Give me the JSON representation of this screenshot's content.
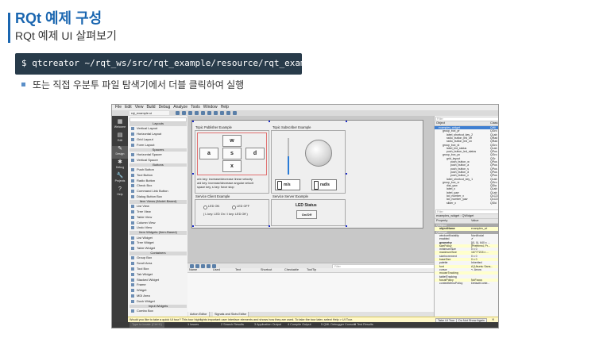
{
  "slide": {
    "title": "RQt 예제 구성",
    "subtitle": "RQt 예제 UI 살펴보기",
    "command": "$ qtcreator ~/rqt_ws/src/rqt_example/resource/rqt_example.ui",
    "bullet": "또는 직접 우분투 파일 탐색기에서 더블 클릭하여 실행",
    "accent_color": "#1a66b0",
    "command_bg": "#283b4a"
  },
  "qt": {
    "menu": [
      "File",
      "Edit",
      "View",
      "Build",
      "Debug",
      "Analyze",
      "Tools",
      "Window",
      "Help"
    ],
    "file_tab": "rqt_example.ui",
    "modes": [
      {
        "icon": "grid-icon",
        "label": "Welcome"
      },
      {
        "icon": "edit-icon",
        "label": "Edit"
      },
      {
        "icon": "design-icon",
        "label": "Design"
      },
      {
        "icon": "debug-icon",
        "label": "Debug"
      },
      {
        "icon": "projects-icon",
        "label": "Projects"
      },
      {
        "icon": "help-icon",
        "label": "Help"
      }
    ],
    "widget_box": [
      {
        "t": "cat",
        "label": "Layouts"
      },
      {
        "t": "item",
        "label": "Vertical Layout"
      },
      {
        "t": "item",
        "label": "Horizontal Layout"
      },
      {
        "t": "item",
        "label": "Grid Layout"
      },
      {
        "t": "item",
        "label": "Form Layout"
      },
      {
        "t": "cat",
        "label": "Spacers"
      },
      {
        "t": "item",
        "label": "Horizontal Spacer"
      },
      {
        "t": "item",
        "label": "Vertical Spacer"
      },
      {
        "t": "cat",
        "label": "Buttons"
      },
      {
        "t": "item",
        "label": "Push Button"
      },
      {
        "t": "item",
        "label": "Tool Button"
      },
      {
        "t": "item",
        "label": "Radio Button"
      },
      {
        "t": "item",
        "label": "Check Box"
      },
      {
        "t": "item",
        "label": "Command Link Button"
      },
      {
        "t": "item",
        "label": "Dialog Button Box"
      },
      {
        "t": "cat",
        "label": "Item Views (Model-Based)"
      },
      {
        "t": "item",
        "label": "List View"
      },
      {
        "t": "item",
        "label": "Tree View"
      },
      {
        "t": "item",
        "label": "Table View"
      },
      {
        "t": "item",
        "label": "Column View"
      },
      {
        "t": "item",
        "label": "Undo View"
      },
      {
        "t": "cat",
        "label": "Item Widgets (Item-Based)"
      },
      {
        "t": "item",
        "label": "List Widget"
      },
      {
        "t": "item",
        "label": "Tree Widget"
      },
      {
        "t": "item",
        "label": "Table Widget"
      },
      {
        "t": "cat",
        "label": "Containers"
      },
      {
        "t": "item",
        "label": "Group Box"
      },
      {
        "t": "item",
        "label": "Scroll Area"
      },
      {
        "t": "item",
        "label": "Tool Box"
      },
      {
        "t": "item",
        "label": "Tab Widget"
      },
      {
        "t": "item",
        "label": "Stacked Widget"
      },
      {
        "t": "item",
        "label": "Frame"
      },
      {
        "t": "item",
        "label": "Widget"
      },
      {
        "t": "item",
        "label": "MDI Area"
      },
      {
        "t": "item",
        "label": "Dock Widget"
      },
      {
        "t": "cat",
        "label": "Input Widgets"
      },
      {
        "t": "item",
        "label": "Combo Box"
      }
    ],
    "form": {
      "publisher_title": "Topic Publisher Example",
      "subscriber_title": "Topic Subscriber Example",
      "keys": [
        "w",
        "a",
        "s",
        "d",
        "x"
      ],
      "help_line1": "w/x key: increase/decrease linear velocity",
      "help_line2": "a/d key: increase/decrease angular velocit",
      "help_line3": "space key, s key: force stop",
      "lcd_digit": "0",
      "lcd_unit_1": "m/s",
      "lcd_unit_2": "rad/s",
      "service_client_title": "Service Client Example",
      "led_on": "LED ON",
      "led_off": "LED OFF",
      "client_help": "( L key: LED On / l key: LED Off )",
      "service_server_title": "Service Server Example",
      "led_status": "LED Status",
      "onoff": "On/Off"
    },
    "action_editor": {
      "filter": "Filter",
      "columns": [
        "Name",
        "Used",
        "Text",
        "Shortcut",
        "Checkable",
        "ToolTip"
      ],
      "tabs": [
        "Action Editor",
        "Signals and Slots Editor"
      ]
    },
    "object_inspector": {
      "filter": "Filter",
      "col_object": "Object",
      "col_class": "Class",
      "rows": [
        {
          "indent": 1,
          "name": "examples_widget",
          "cls": "QWi",
          "sel": true
        },
        {
          "indent": 2,
          "name": "group_box_pr",
          "cls": "QGro"
        },
        {
          "indent": 3,
          "name": "label_shortcut_key_2",
          "cls": "QLab"
        },
        {
          "indent": 3,
          "name": "radio_button_led_off",
          "cls": "QRad"
        },
        {
          "indent": 3,
          "name": "radio_button_led_on",
          "cls": "QRad"
        },
        {
          "indent": 2,
          "name": "group_box_st",
          "cls": "QGro"
        },
        {
          "indent": 3,
          "name": "label_led_status",
          "cls": "QLab"
        },
        {
          "indent": 3,
          "name": "push_button_led_status",
          "cls": "QPus"
        },
        {
          "indent": 2,
          "name": "group_box_pc",
          "cls": "QGro"
        },
        {
          "indent": 3,
          "name": "grid_layout",
          "cls": "QGr"
        },
        {
          "indent": 4,
          "name": "push_button_w",
          "cls": "QPus"
        },
        {
          "indent": 4,
          "name": "push_button_a",
          "cls": "QPus"
        },
        {
          "indent": 4,
          "name": "push_button_s",
          "cls": "QPus"
        },
        {
          "indent": 4,
          "name": "push_button_d",
          "cls": "QPus"
        },
        {
          "indent": 4,
          "name": "push_button_x",
          "cls": "QPus"
        },
        {
          "indent": 3,
          "name": "label_shortcut_key_1",
          "cls": "QLab"
        },
        {
          "indent": 2,
          "name": "group_box_vr",
          "cls": "QGro"
        },
        {
          "indent": 3,
          "name": "dial_yaw",
          "cls": "QDia"
        },
        {
          "indent": 3,
          "name": "label_x",
          "cls": "QLab"
        },
        {
          "indent": 3,
          "name": "label_yaw",
          "cls": "QLab"
        },
        {
          "indent": 3,
          "name": "lcd_number_x",
          "cls": "QLCD"
        },
        {
          "indent": 3,
          "name": "lcd_number_yaw",
          "cls": "QLCD"
        },
        {
          "indent": 3,
          "name": "slider_x",
          "cls": "QSld"
        }
      ]
    },
    "property_editor": {
      "filter": "Filter",
      "object_line": "examples_widget : QWidget",
      "col_property": "Property",
      "col_value": "Value",
      "rows": [
        {
          "kind": "cat",
          "name": "QObject",
          "value": ""
        },
        {
          "kind": "hl",
          "name": "objectName",
          "value": "examples_wi"
        },
        {
          "kind": "cat",
          "name": "QWidget",
          "value": ""
        },
        {
          "kind": "row",
          "name": "windowModality",
          "value": "NonModal"
        },
        {
          "kind": "row",
          "name": "enabled",
          "value": "✔"
        },
        {
          "kind": "row",
          "name": "geometry",
          "value": "[(0, 0), 640 x ..."
        },
        {
          "kind": "hl",
          "name": "sizePolicy",
          "value": "[Preferred, Pr..."
        },
        {
          "kind": "row",
          "name": "minimumSize",
          "value": "0 x 0"
        },
        {
          "kind": "hl",
          "name": "maximumSize",
          "value": "16777215 x ..."
        },
        {
          "kind": "row",
          "name": "sizeIncrement",
          "value": "0 x 0"
        },
        {
          "kind": "hl",
          "name": "baseSize",
          "value": "0 x 0"
        },
        {
          "kind": "row",
          "name": "palette",
          "value": "Inherited"
        },
        {
          "kind": "hl",
          "name": "font",
          "value": "A  [Ubuntu Sans..."
        },
        {
          "kind": "row",
          "name": "cursor",
          "value": "↖ Arrow"
        },
        {
          "kind": "hl",
          "name": "mouseTracking",
          "value": ""
        },
        {
          "kind": "row",
          "name": "tabletTracking",
          "value": ""
        },
        {
          "kind": "hl",
          "name": "focusPolicy",
          "value": "NoFocus"
        },
        {
          "kind": "row",
          "name": "contextMenuPolicy",
          "value": "DefaultConte..."
        }
      ]
    },
    "tour": {
      "message": "Would you like to take a quick UI tour? This tour highlights important user interface elements and shows how they are used. To take the tour later, select Help > UI Tour.",
      "take_tour": "Take UI Tour",
      "dont_show": "Do Not Show Again"
    },
    "status": {
      "locator": "Type to locate (Ctrl+K)",
      "items": [
        "1  Issues",
        "2  Search Results",
        "3  Application Output",
        "4  Compile Output",
        "5  QML Debugger Console",
        "6  Test Results"
      ]
    }
  }
}
